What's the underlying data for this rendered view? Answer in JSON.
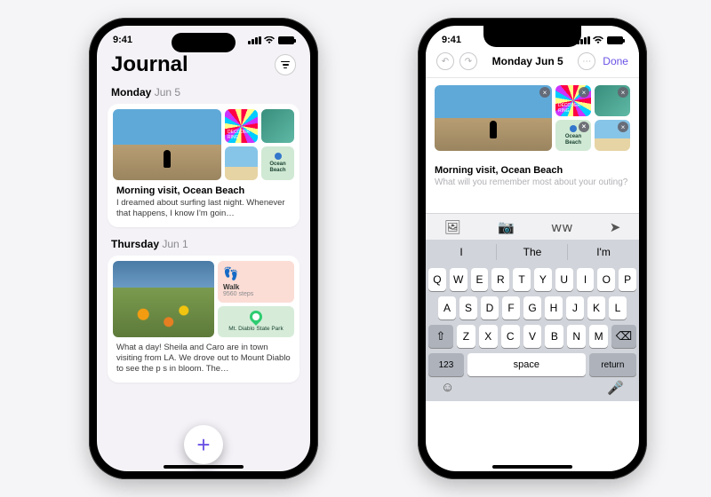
{
  "status": {
    "time": "9:41"
  },
  "left": {
    "title": "Journal",
    "entries": [
      {
        "dow": "Monday",
        "md": "Jun 5",
        "title": "Morning visit, Ocean Beach",
        "body": "I dreamed about surfing last night. Whenever that happens, I know I'm goin…",
        "decoder_label": "DECODER RING",
        "map_label": "Ocean Beach"
      },
      {
        "dow": "Thursday",
        "md": "Jun 1",
        "walk_label": "Walk",
        "walk_steps": "9560 steps",
        "park_label": "Mt. Diablo State Park",
        "body": "What a day! Sheila and Caro are in town visiting from LA. We drove out to Mount Diablo to see the p           s in bloom. The…"
      }
    ]
  },
  "right": {
    "toolbar_date": "Monday Jun 5",
    "done": "Done",
    "entry_title": "Morning visit, Ocean Beach",
    "placeholder": "What will you remember most about your outing?",
    "map_label": "Ocean Beach",
    "decoder_label": "DECODER RING",
    "predictive": [
      "I",
      "The",
      "I'm"
    ],
    "keyboard": {
      "row1": [
        "Q",
        "W",
        "E",
        "R",
        "T",
        "Y",
        "U",
        "I",
        "O",
        "P"
      ],
      "row2": [
        "A",
        "S",
        "D",
        "F",
        "G",
        "H",
        "J",
        "K",
        "L"
      ],
      "row3": [
        "Z",
        "X",
        "C",
        "V",
        "B",
        "N",
        "M"
      ],
      "num": "123",
      "space": "space",
      "ret": "return"
    }
  }
}
